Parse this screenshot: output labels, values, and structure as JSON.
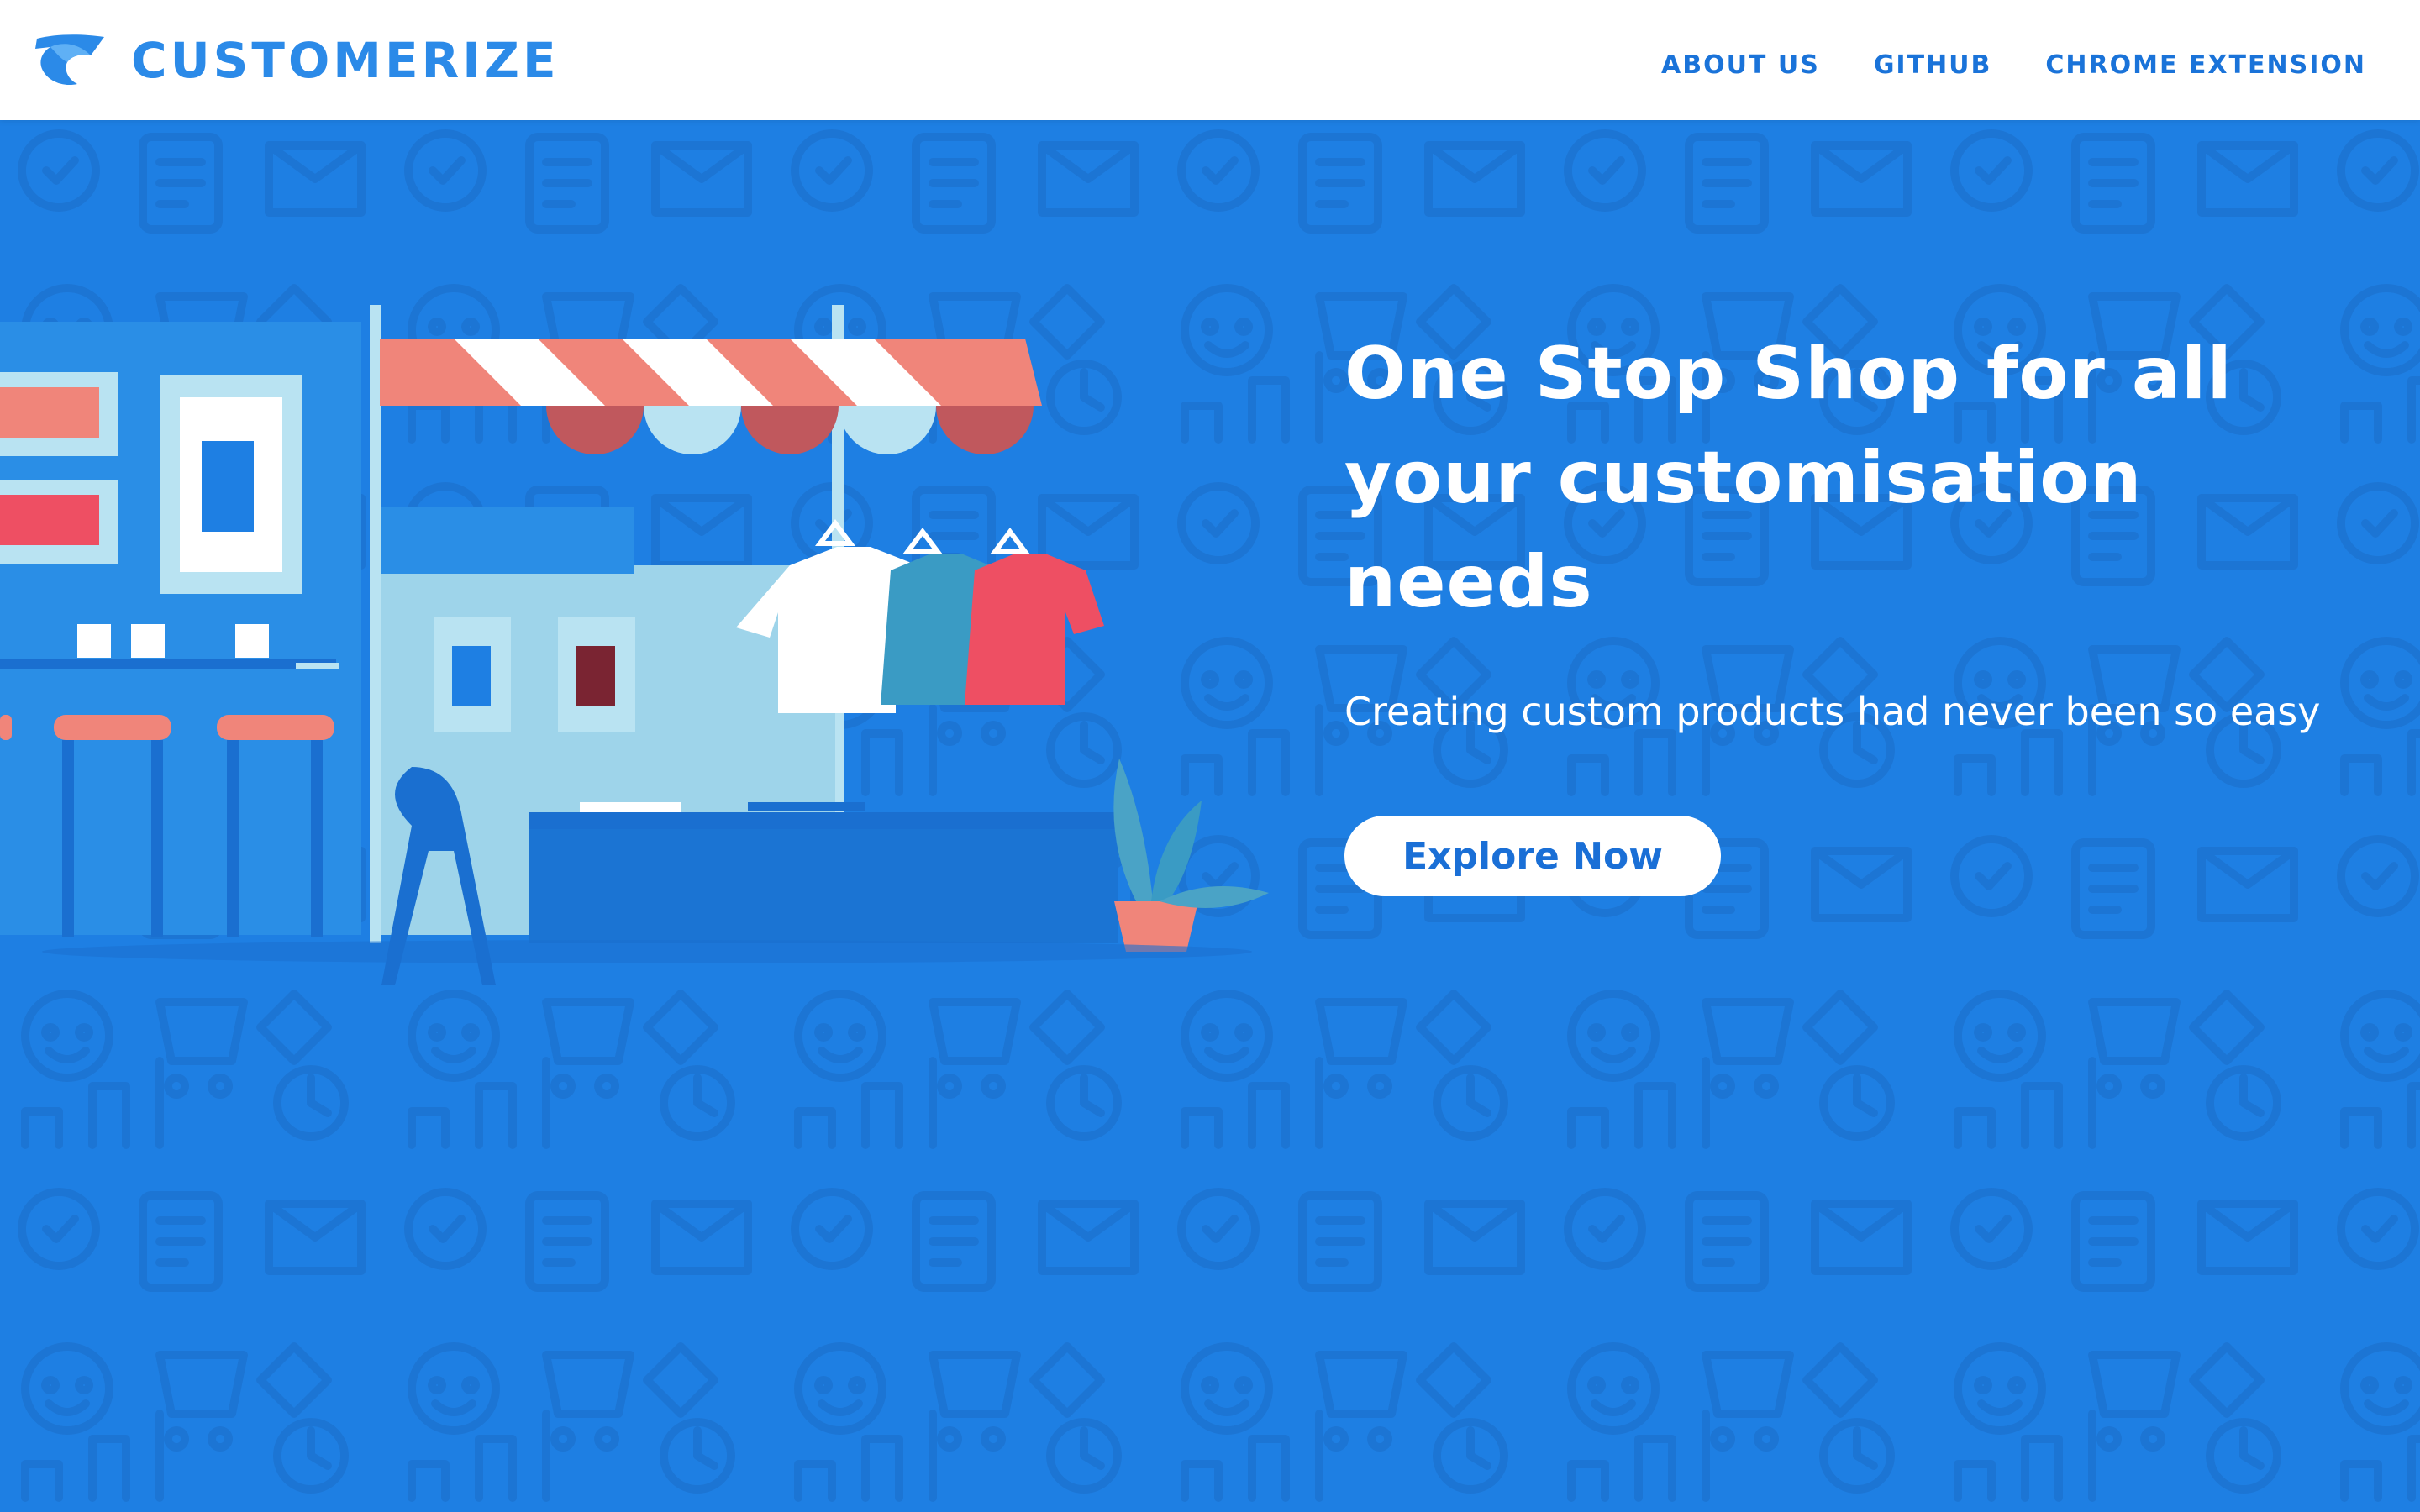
{
  "brand": {
    "name": "CUSTOMERIZE",
    "logo_icon": "customerize-logo-icon"
  },
  "nav": {
    "items": [
      {
        "label": "ABOUT US"
      },
      {
        "label": "GITHUB"
      },
      {
        "label": "CHROME EXTENSION"
      }
    ]
  },
  "hero": {
    "headline": "One Stop Shop for all your customisation needs",
    "subheadline": "Creating custom products had never been so easy",
    "cta_label": "Explore Now",
    "illustration": "storefront-illustration",
    "background_pattern": "shopping-icons-pattern"
  },
  "colors": {
    "brand": "#2b8ae8",
    "nav_link": "#1a73d9",
    "hero_background": "#1e7fe3",
    "cta_text": "#1a6fd6",
    "awning_red": "#f0857a",
    "shirt_red": "#ee4f63",
    "shirt_teal": "#3a9bc4"
  }
}
